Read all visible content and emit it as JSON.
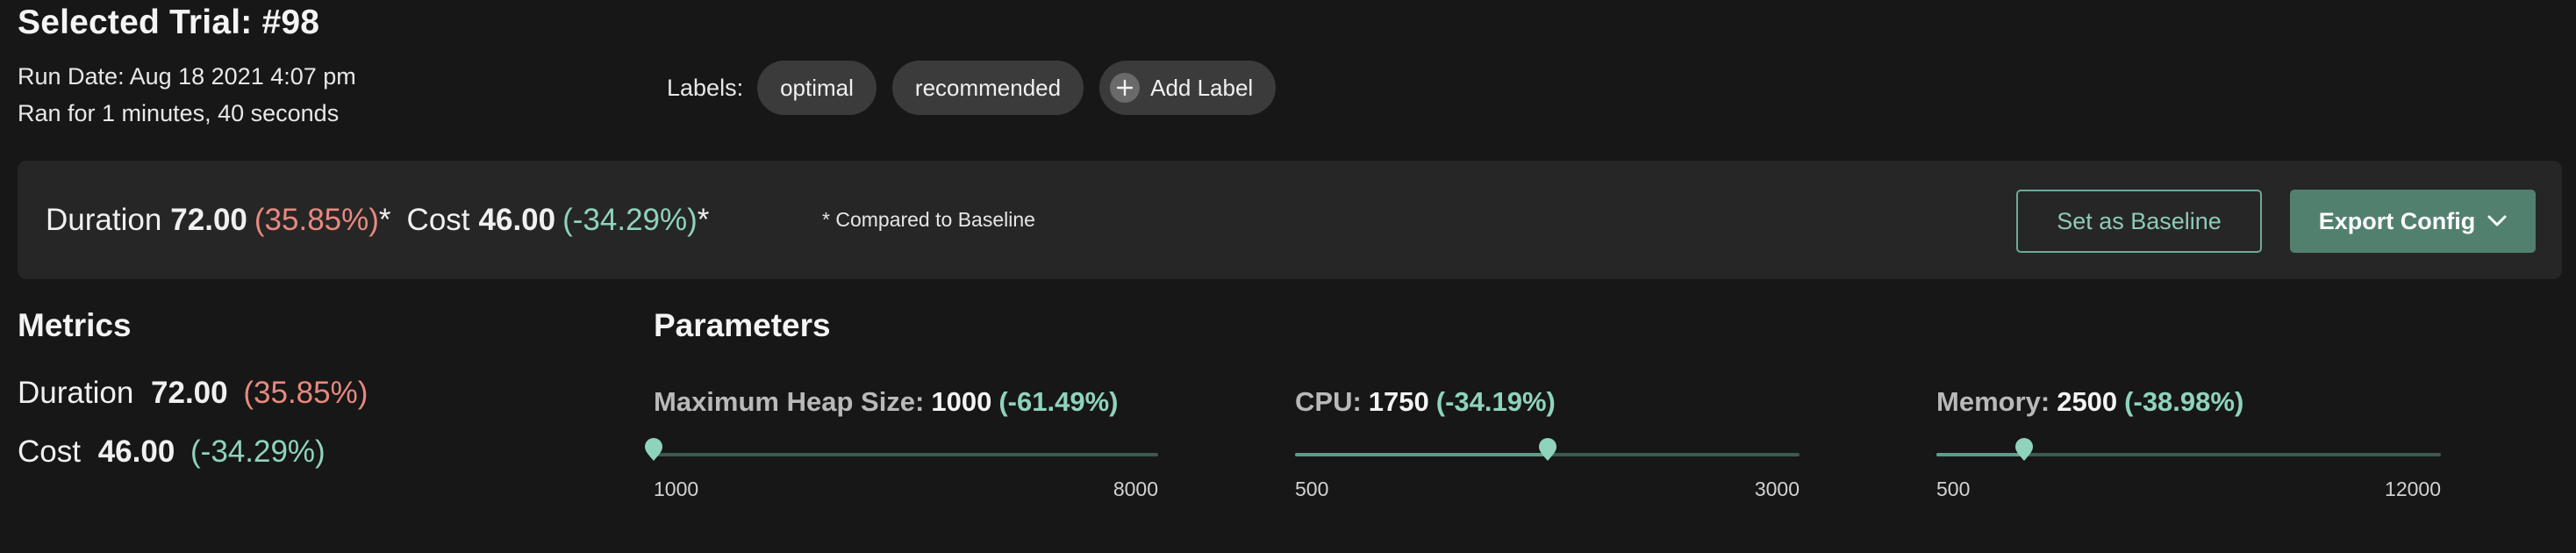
{
  "header": {
    "title": "Selected Trial: #98",
    "run_date": "Run Date: Aug 18 2021 4:07 pm",
    "ran_for": "Ran for 1 minutes, 40 seconds"
  },
  "labels": {
    "caption": "Labels:",
    "items": [
      "optimal",
      "recommended"
    ],
    "add_label": "Add Label"
  },
  "summary": {
    "duration": {
      "name": "Duration",
      "value": "72.00",
      "pct": "(35.85%)",
      "asterisk": "*"
    },
    "cost": {
      "name": "Cost",
      "value": "46.00",
      "pct": "(-34.29%)",
      "asterisk": "*"
    },
    "note": "* Compared to Baseline",
    "set_baseline_label": "Set as Baseline",
    "export_label": "Export Config"
  },
  "metrics": {
    "heading": "Metrics",
    "duration": {
      "name": "Duration",
      "value": "72.00",
      "pct": "(35.85%)"
    },
    "cost": {
      "name": "Cost",
      "value": "46.00",
      "pct": "(-34.29%)"
    }
  },
  "parameters": {
    "heading": "Parameters",
    "items": [
      {
        "name": "Maximum Heap Size:",
        "value": "1000",
        "pct": "(-61.49%)",
        "min": "1000",
        "max": "8000",
        "current": 1000,
        "min_num": 1000,
        "max_num": 8000
      },
      {
        "name": "CPU:",
        "value": "1750",
        "pct": "(-34.19%)",
        "min": "500",
        "max": "3000",
        "current": 1750,
        "min_num": 500,
        "max_num": 3000
      },
      {
        "name": "Memory:",
        "value": "2500",
        "pct": "(-38.98%)",
        "min": "500",
        "max": "12000",
        "current": 2500,
        "min_num": 500,
        "max_num": 12000
      }
    ]
  },
  "colors": {
    "background": "#171717",
    "panel": "#262626",
    "accent": "#52806f",
    "positive": "#8fd3bd",
    "negative": "#e8897f",
    "icons": [
      "plus-icon",
      "chevron-down-icon",
      "slider-thumb-icon"
    ]
  }
}
